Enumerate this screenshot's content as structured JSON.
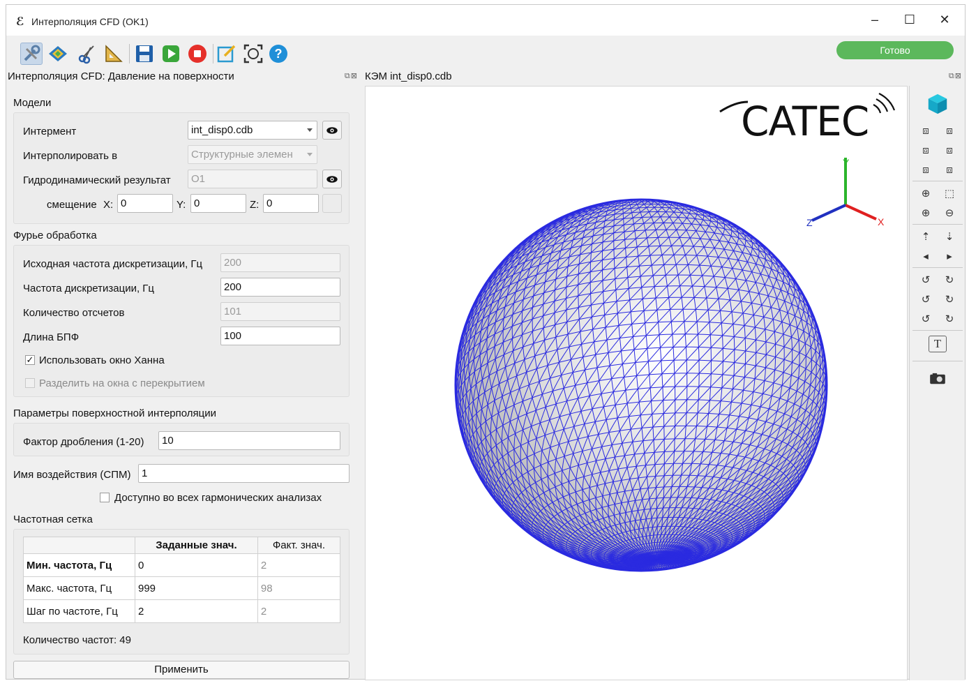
{
  "window": {
    "title": "Интерполяция CFD (OK1)",
    "controls": {
      "minimize": "–",
      "maximize": "☐",
      "close": "✕"
    }
  },
  "toolbar": {
    "status": "Готово",
    "status_color": "#5cb85c",
    "icons": [
      "tools-icon",
      "surface-map-icon",
      "cut-icon",
      "ruler-triangle-icon",
      "save-icon",
      "play-icon",
      "stop-icon",
      "edit-icon",
      "fit-view-icon",
      "help-icon"
    ]
  },
  "left_panel": {
    "title": "Интерполяция CFD: Давление на поверхности",
    "models": {
      "header": "Модели",
      "interment_label": "Интермент",
      "interment_value": "int_disp0.cdb",
      "interpolate_label": "Интерполировать в",
      "interpolate_value": "Структурные элемен",
      "cfd_label": "Гидродинамический результат",
      "cfd_value": "O1",
      "offset_label": "смещение",
      "x_label": "X:",
      "x_value": "0",
      "y_label": "Y:",
      "y_value": "0",
      "z_label": "Z:",
      "z_value": "0"
    },
    "fourier": {
      "header": "Фурье обработка",
      "source_rate_label": "Исходная частота дискретизации, Гц",
      "source_rate_value": "200",
      "rate_label": "Частота дискретизации, Гц",
      "rate_value": "200",
      "samples_label": "Количество отсчетов",
      "samples_value": "101",
      "fft_label": "Длина БПФ",
      "fft_value": "100",
      "hann_label": "Использовать окно Ханна",
      "hann_checked": true,
      "overlap_label": "Разделить на окна с перекрытием",
      "overlap_checked": false
    },
    "surface": {
      "header": "Параметры поверхностной интерполяции",
      "refine_label": "Фактор дробления (1-20)",
      "refine_value": "10"
    },
    "load_name_label": "Имя воздействия (СПМ)",
    "load_name_value": "1",
    "available_label": "Доступно во всех гармонических анализах",
    "freq_grid": {
      "header": "Частотная сетка",
      "columns": [
        "",
        "Заданные знач.",
        "Факт. знач."
      ],
      "rows": [
        {
          "label": "Мин. частота, Гц",
          "set": "0",
          "actual": "2"
        },
        {
          "label": "Макс. частота, Гц",
          "set": "999",
          "actual": "98"
        },
        {
          "label": "Шаг по частоте, Гц",
          "set": "2",
          "actual": "2"
        }
      ],
      "count_text": "Количество частот: 49"
    },
    "apply_label": "Применить"
  },
  "viewer": {
    "title": "КЭМ int_disp0.cdb",
    "logo_text": "CATEC",
    "axes": {
      "x": "X",
      "y": "Y",
      "z": "Z"
    },
    "mesh_color": "#2a2ae0"
  },
  "sidebar_icons": [
    "iso-cube-icon",
    "view-front-icon",
    "view-back-icon",
    "view-left-icon",
    "view-right-icon",
    "view-top-icon",
    "view-bottom-icon",
    "zoom-fit-icon",
    "zoom-window-icon",
    "zoom-in-icon",
    "zoom-out-icon",
    "pan-up-icon",
    "pan-down-icon",
    "pan-left-icon",
    "pan-right-icon",
    "rotate-x-ccw-icon",
    "rotate-x-cw-icon",
    "rotate-y-ccw-icon",
    "rotate-y-cw-icon",
    "rotate-z-ccw-icon",
    "rotate-z-cw-icon",
    "text-annotation-icon",
    "screenshot-icon"
  ]
}
